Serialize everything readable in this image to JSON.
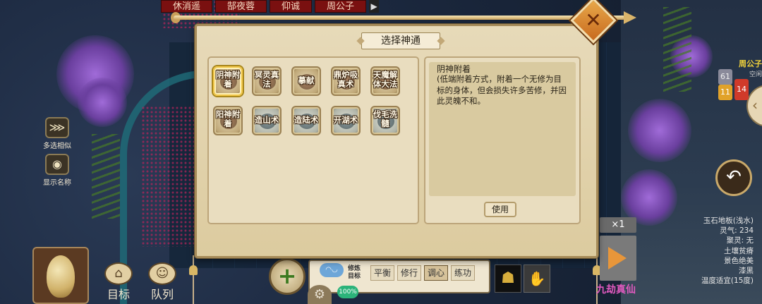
{
  "top_tabs": [
    "休消遥",
    "郜夜蓉",
    "仰诚",
    "周公子"
  ],
  "top_tabs_arrow": "▶",
  "side_tools": [
    {
      "label": "多选相似",
      "icon": "multi-select-icon"
    },
    {
      "label": "显示名称",
      "icon": "eye-icon"
    }
  ],
  "bottom_left": {
    "goal_label": "目标",
    "team_label": "队列"
  },
  "mode_bar": {
    "goal_text": "修炼目标",
    "modes": [
      "平衡",
      "修行",
      "调心",
      "练功"
    ],
    "active_mode": "调心",
    "progress": "100%"
  },
  "speed": "×1",
  "realm_label": "九劫真仙",
  "npc": {
    "name": "周公子",
    "status": "空闲",
    "badges": [
      "61",
      "11",
      "14"
    ]
  },
  "tile_info": [
    "玉石地板(浅水)",
    "灵气: 234",
    "聚灵: 无",
    "土壤贫瘠",
    "景色绝美",
    "漆黑",
    "温度适宜(15度)"
  ],
  "dialog": {
    "title": "选择神通",
    "skills": [
      {
        "label": "阴神附着",
        "selected": true,
        "tint": "gold"
      },
      {
        "label": "冥灵真法",
        "selected": false,
        "tint": "gold"
      },
      {
        "label": "摹献",
        "selected": false,
        "tint": "gold"
      },
      {
        "label": "鼎炉吸真术",
        "selected": false,
        "tint": "gold"
      },
      {
        "label": "天魔解体大法",
        "selected": false,
        "tint": "gold"
      },
      {
        "label": "阳神附着",
        "selected": false,
        "tint": "gold"
      },
      {
        "label": "造山术",
        "selected": false,
        "tint": "cool"
      },
      {
        "label": "造陆术",
        "selected": false,
        "tint": "cool"
      },
      {
        "label": "开湖术",
        "selected": false,
        "tint": "cool"
      },
      {
        "label": "伐毛洗髓",
        "selected": false,
        "tint": "cool"
      }
    ],
    "info": {
      "title": "阴神附着",
      "description": "(低端附着方式，附着一个无修为目标的身体，但会损失许多苦修，并因此灵魄不和。"
    },
    "use_label": "使用"
  },
  "colors": {
    "selected_border": "#f2c84a",
    "panel_bg": "#e9ddbf",
    "realm_color": "#e25ac0",
    "npc_name_color": "#f1d23b"
  }
}
